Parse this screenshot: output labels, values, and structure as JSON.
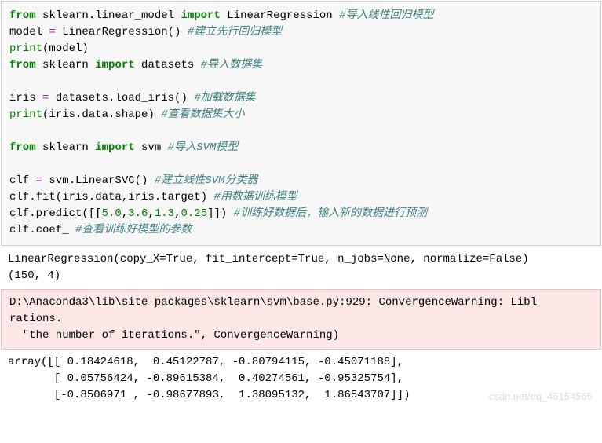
{
  "code": {
    "l1_from": "from",
    "l1_mod": " sklearn.linear_model ",
    "l1_import": "import",
    "l1_name": " LinearRegression ",
    "l1_comment": "#导入线性回归模型",
    "l2_pre": "model ",
    "l2_eq": "=",
    "l2_post": " LinearRegression() ",
    "l2_comment": "#建立先行回归模型",
    "l3_print": "print",
    "l3_post": "(model)",
    "l4_from": "from",
    "l4_mod": " sklearn ",
    "l4_import": "import",
    "l4_name": " datasets ",
    "l4_comment": "#导入数据集",
    "l5": "",
    "l6_pre": "iris ",
    "l6_eq": "=",
    "l6_post": " datasets.load_iris() ",
    "l6_comment": "#加载数据集",
    "l7_print": "print",
    "l7_post": "(iris.data.shape) ",
    "l7_comment": "#查看数据集大小",
    "l8": "",
    "l9_from": "from",
    "l9_mod": " sklearn ",
    "l9_import": "import",
    "l9_name": " svm ",
    "l9_comment": "#导入SVM模型",
    "l10": "",
    "l11_pre": "clf ",
    "l11_eq": "=",
    "l11_post": " svm.LinearSVC() ",
    "l11_comment": "#建立线性SVM分类器",
    "l12_pre": "clf.fit(iris.data,iris.target) ",
    "l12_comment": "#用数据训练模型",
    "l13_pre": "clf.predict([[",
    "l13_n1": "5.0",
    "l13_c1": ",",
    "l13_n2": "3.6",
    "l13_c2": ",",
    "l13_n3": "1.3",
    "l13_c3": ",",
    "l13_n4": "0.25",
    "l13_post": "]]) ",
    "l13_comment": "#训练好数据后，输入新的数据进行预测",
    "l14_pre": "clf.coef_ ",
    "l14_comment": "#查看训练好模型的参数"
  },
  "output1": {
    "line1": "LinearRegression(copy_X=True, fit_intercept=True, n_jobs=None, normalize=False)",
    "line2": "(150, 4)"
  },
  "warning": {
    "line1": "D:\\Anaconda3\\lib\\site-packages\\sklearn\\svm\\base.py:929: ConvergenceWarning: Libl",
    "line2": "rations.",
    "line3": "  \"the number of iterations.\", ConvergenceWarning)"
  },
  "output2": {
    "line1": "array([[ 0.18424618,  0.45122787, -0.80794115, -0.45071188],",
    "line2": "       [ 0.05756424, -0.89615384,  0.40274561, -0.95325754],",
    "line3": "       [-0.8506971 , -0.98677893,  1.38095132,  1.86543707]])"
  },
  "watermark": "csdn.net/qq_45154565"
}
